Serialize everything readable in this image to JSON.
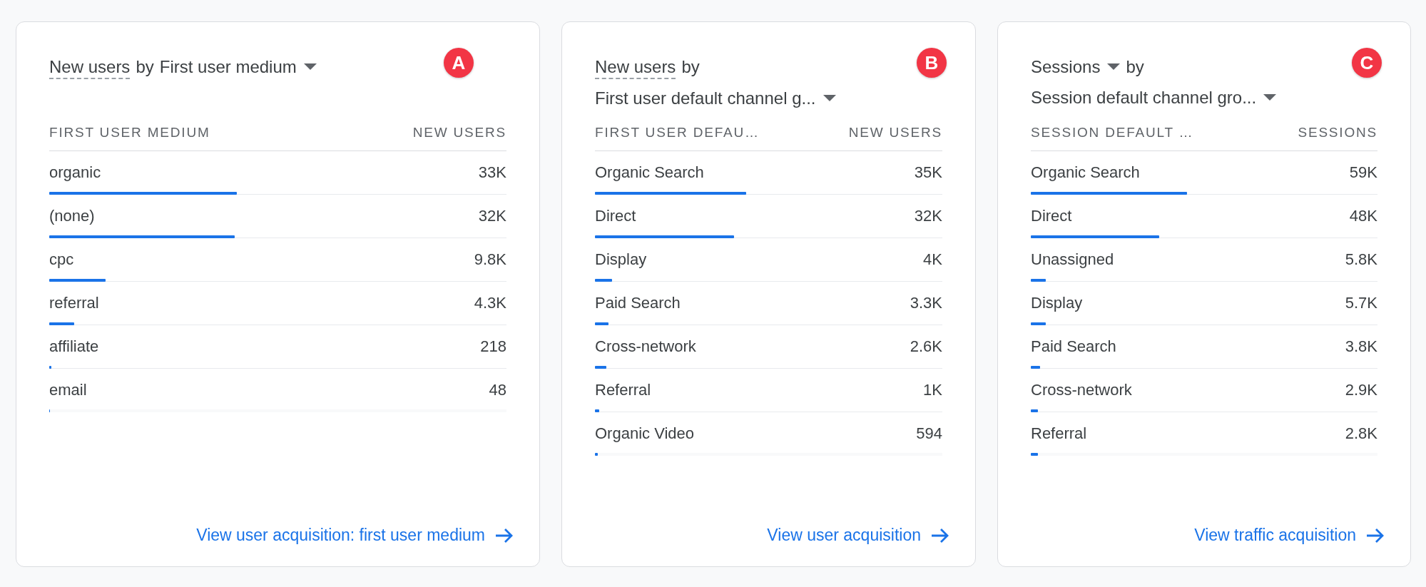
{
  "cards": [
    {
      "badge": "A",
      "title": {
        "metric": "New users",
        "metric_dashed": true,
        "metric_dropdown": false,
        "connector": "by",
        "dimension": "First user medium",
        "dimension_dropdown": true
      },
      "columns": [
        "FIRST USER MEDIUM",
        "NEW USERS"
      ],
      "rows": [
        {
          "label": "organic",
          "value": "33K",
          "level": 0.41
        },
        {
          "label": "(none)",
          "value": "32K",
          "level": 0.405
        },
        {
          "label": "cpc",
          "value": "9.8K",
          "level": 0.123
        },
        {
          "label": "referral",
          "value": "4.3K",
          "level": 0.054
        },
        {
          "label": "affiliate",
          "value": "218",
          "level": 0.004
        },
        {
          "label": "email",
          "value": "48",
          "level": 0.002
        }
      ],
      "link": "View user acquisition: first user medium"
    },
    {
      "badge": "B",
      "title": {
        "metric": "New users",
        "metric_dashed": true,
        "metric_dropdown": false,
        "connector": "by",
        "dimension": "First user default channel g...",
        "dimension_dropdown": true
      },
      "columns": [
        "FIRST USER DEFAU…",
        "NEW USERS"
      ],
      "rows": [
        {
          "label": "Organic Search",
          "value": "35K",
          "level": 0.435
        },
        {
          "label": "Direct",
          "value": "32K",
          "level": 0.4
        },
        {
          "label": "Display",
          "value": "4K",
          "level": 0.05
        },
        {
          "label": "Paid Search",
          "value": "3.3K",
          "level": 0.04
        },
        {
          "label": "Cross-network",
          "value": "2.6K",
          "level": 0.032
        },
        {
          "label": "Referral",
          "value": "1K",
          "level": 0.013
        },
        {
          "label": "Organic Video",
          "value": "594",
          "level": 0.008
        }
      ],
      "link": "View user acquisition"
    },
    {
      "badge": "C",
      "title": {
        "metric": "Sessions",
        "metric_dashed": false,
        "metric_dropdown": true,
        "connector": "by",
        "dimension": "Session default channel gro...",
        "dimension_dropdown": true
      },
      "columns": [
        "SESSION DEFAULT …",
        "SESSIONS"
      ],
      "rows": [
        {
          "label": "Organic Search",
          "value": "59K",
          "level": 0.45
        },
        {
          "label": "Direct",
          "value": "48K",
          "level": 0.37
        },
        {
          "label": "Unassigned",
          "value": "5.8K",
          "level": 0.044
        },
        {
          "label": "Display",
          "value": "5.7K",
          "level": 0.044
        },
        {
          "label": "Paid Search",
          "value": "3.8K",
          "level": 0.026
        },
        {
          "label": "Cross-network",
          "value": "2.9K",
          "level": 0.02
        },
        {
          "label": "Referral",
          "value": "2.8K",
          "level": 0.02
        }
      ],
      "link": "View traffic acquisition"
    }
  ]
}
